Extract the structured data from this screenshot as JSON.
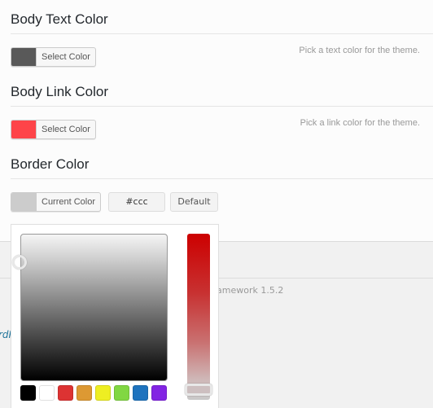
{
  "sections": [
    {
      "title": "Body Text Color",
      "button_label": "Select Color",
      "swatch_color": "#595959",
      "description": "Pick a text color for the theme."
    },
    {
      "title": "Body Link Color",
      "button_label": "Select Color",
      "swatch_color": "#fe4449",
      "description": "Pick a link color for the theme."
    },
    {
      "title": "Border Color",
      "button_label": "Current Color",
      "swatch_color": "#cccccc",
      "hex_value": "#ccc",
      "default_label": "Default"
    }
  ],
  "picker": {
    "palette": [
      "#000000",
      "#ffffff",
      "#dd3333",
      "#dd9933",
      "#eeee22",
      "#81d742",
      "#1e73be",
      "#8224e3"
    ]
  },
  "footer": {
    "version_text": "amework 1.5.2",
    "wordpress_text": "rdPress."
  }
}
